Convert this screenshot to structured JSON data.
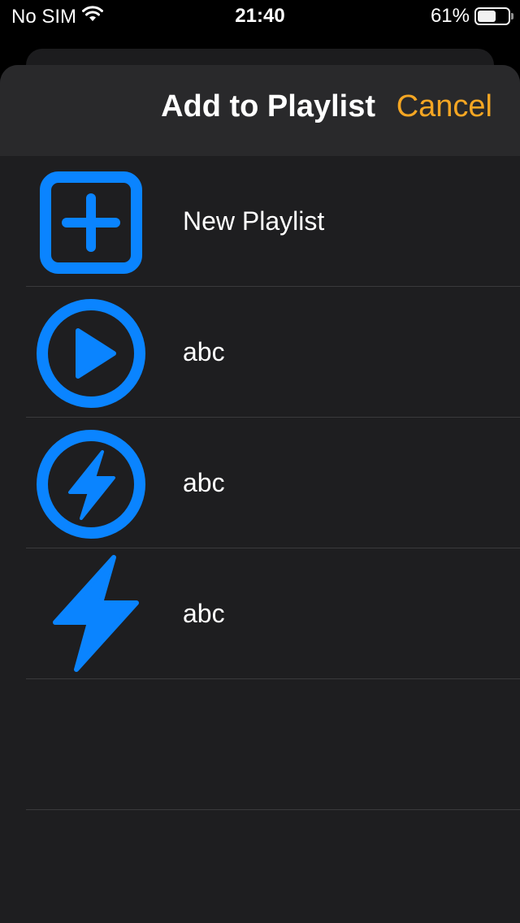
{
  "status_bar": {
    "carrier": "No SIM",
    "time": "21:40",
    "battery_percent": "61%",
    "battery_level": 0.61,
    "wifi_icon": "wifi-icon",
    "battery_icon": "battery-icon"
  },
  "nav": {
    "title": "Add to Playlist",
    "cancel_label": "Cancel"
  },
  "colors": {
    "accent_blue": "#0a84ff",
    "cancel_orange": "#f5a623",
    "sheet_bg": "#1e1e20",
    "nav_bg": "#29292b"
  },
  "rows": [
    {
      "label": "New Playlist",
      "icon": "plus-square-icon"
    },
    {
      "label": "abc",
      "icon": "play-circle-icon"
    },
    {
      "label": "abc",
      "icon": "bolt-circle-icon"
    },
    {
      "label": "abc",
      "icon": "bolt-icon"
    }
  ]
}
